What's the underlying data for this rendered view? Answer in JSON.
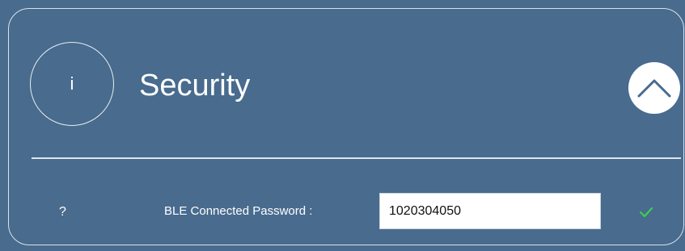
{
  "section": {
    "info_icon_glyph": "i",
    "title": "Security",
    "collapse_icon": "chevron-up-icon"
  },
  "fields": [
    {
      "help_glyph": "?",
      "label": "BLE Connected Password :",
      "value": "1020304050",
      "status_icon": "check-icon",
      "status_color": "#3ecf4e"
    }
  ],
  "colors": {
    "panel_background": "#486b8e",
    "border": "#d9e2ec"
  }
}
